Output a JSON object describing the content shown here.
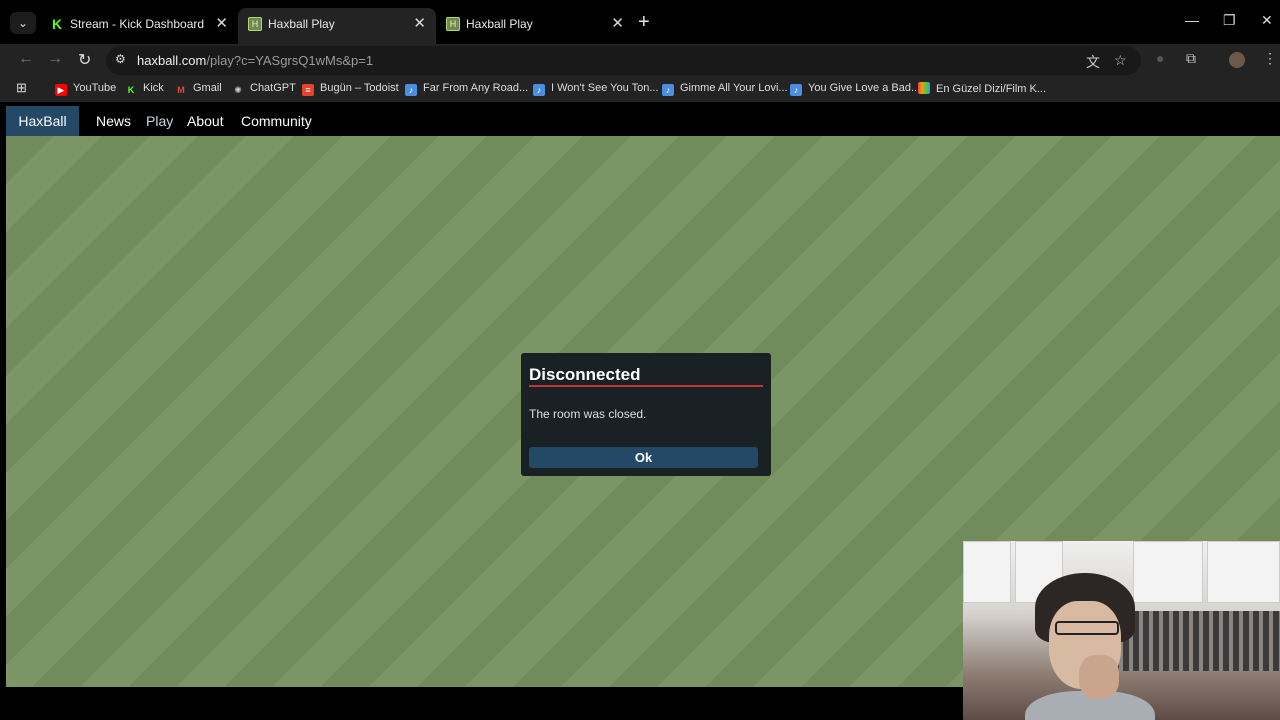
{
  "browser": {
    "tabs": [
      {
        "title": "Stream - Kick Dashboard",
        "favicon": "kick-icon",
        "active": false
      },
      {
        "title": "Haxball Play",
        "favicon": "haxball-icon",
        "active": true
      },
      {
        "title": "Haxball Play",
        "favicon": "haxball-icon",
        "active": false
      }
    ],
    "url_host": "haxball.com",
    "url_path": "/play?c=YASgrsQ1wMs&p=1",
    "bookmarks": [
      {
        "label": "YouTube",
        "icon": "youtube-icon",
        "color": "#ff0000"
      },
      {
        "label": "Kick",
        "icon": "kick-icon",
        "color": "#53fc18"
      },
      {
        "label": "Gmail",
        "icon": "gmail-icon",
        "color": "#ea4335"
      },
      {
        "label": "ChatGPT",
        "icon": "chatgpt-icon",
        "color": "#cccccc"
      },
      {
        "label": "Bugün – Todoist",
        "icon": "todoist-icon",
        "color": "#e44332"
      },
      {
        "label": "Far From Any Road...",
        "icon": "page-icon",
        "color": "#4a90e2"
      },
      {
        "label": "I Won't See You Ton...",
        "icon": "page-icon",
        "color": "#4a90e2"
      },
      {
        "label": "Gimme All Your Lovi...",
        "icon": "page-icon",
        "color": "#4a90e2"
      },
      {
        "label": "You Give Love a Bad...",
        "icon": "page-icon",
        "color": "#4a90e2"
      },
      {
        "label": "En Güzel Dizi/Film K...",
        "icon": "rainbow-icon",
        "color": "#f0a030"
      }
    ]
  },
  "site": {
    "logo": "HaxBall",
    "nav": [
      "News",
      "Play",
      "About",
      "Community"
    ],
    "current": "Play",
    "accent": "#244967"
  },
  "dialog": {
    "title": "Disconnected",
    "message": "The room was closed.",
    "ok_label": "Ok",
    "rule_color": "#c13535"
  }
}
